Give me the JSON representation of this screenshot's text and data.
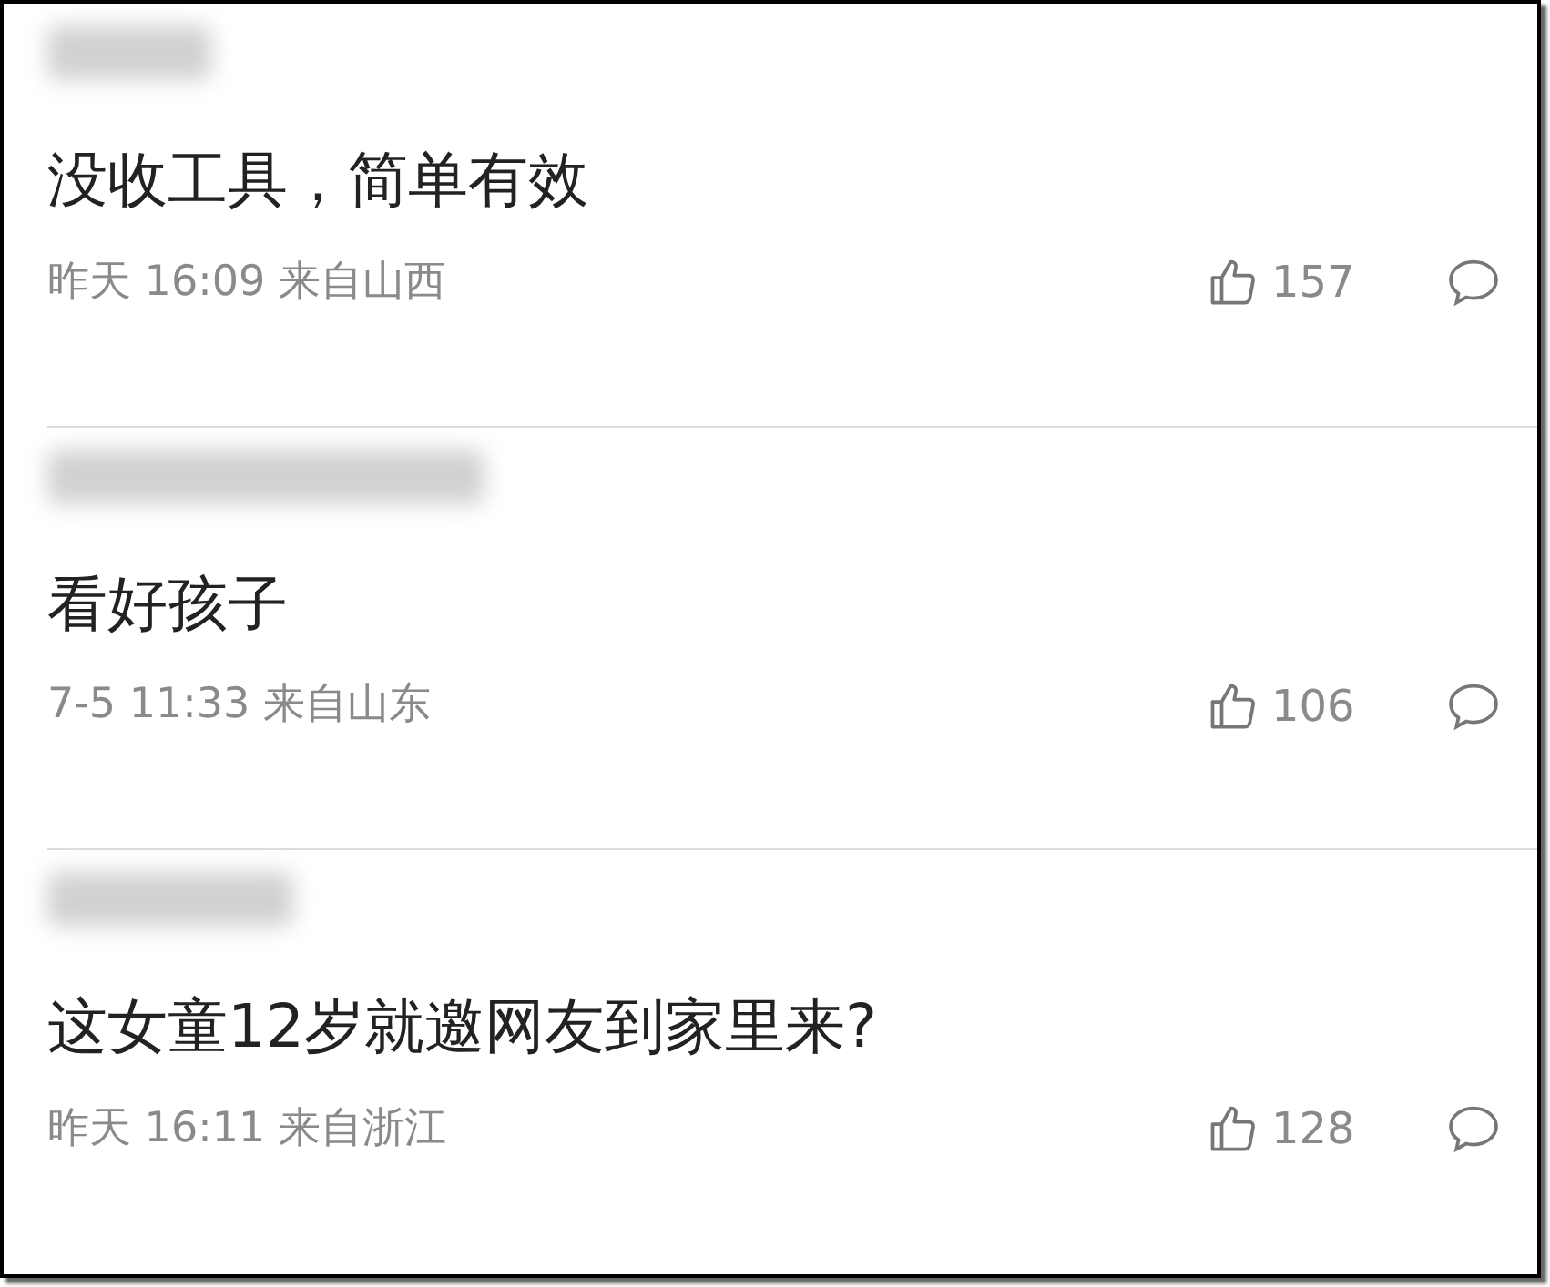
{
  "comments": [
    {
      "text": "没收工具，简单有效",
      "time": "昨天 16:09 来自山西",
      "likes": "157"
    },
    {
      "text": "看好孩子",
      "time": "7-5 11:33 来自山东",
      "likes": "106"
    },
    {
      "text": "这女童12岁就邀网友到家里来?",
      "time": "昨天 16:11 来自浙江",
      "likes": "128"
    }
  ]
}
